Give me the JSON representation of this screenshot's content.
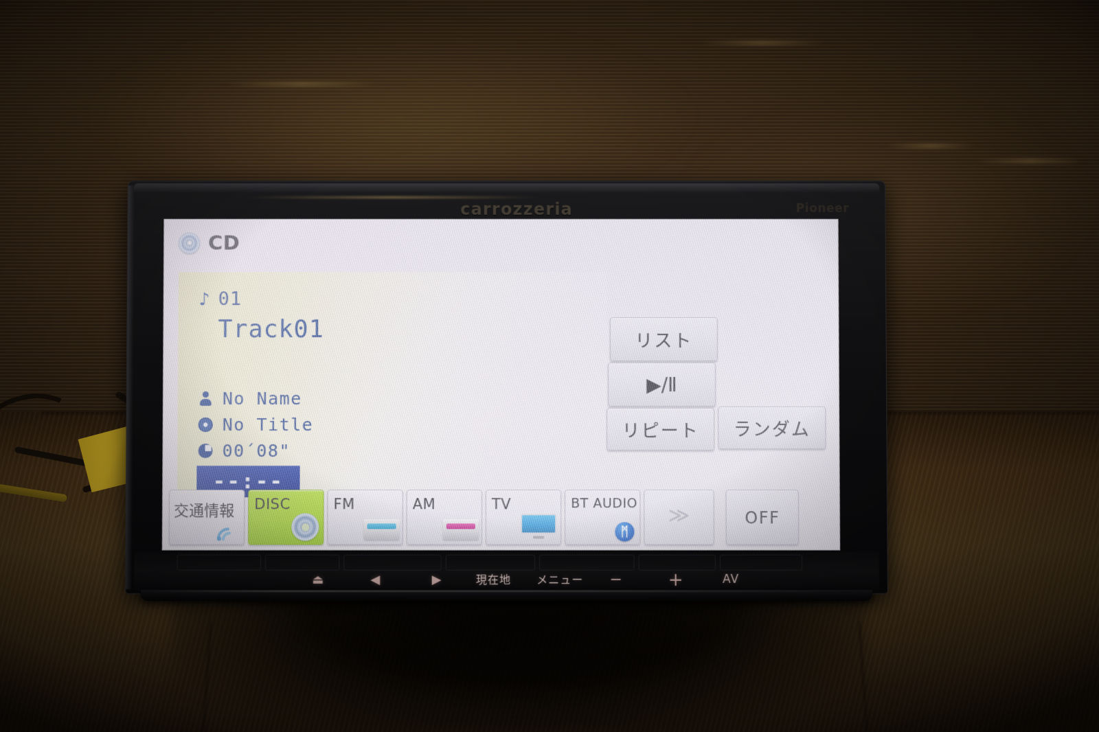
{
  "device": {
    "brand_left": "carrozzeria",
    "brand_right": "Pioneer"
  },
  "screen": {
    "source_header": {
      "icon": "cd-disc-icon",
      "label": "CD"
    },
    "now_playing": {
      "note_icon": "♪",
      "track_number": "01",
      "track_title": "Track01",
      "meta": [
        {
          "icon": "person-icon",
          "text": "No Name"
        },
        {
          "icon": "disc-icon",
          "text": "No Title"
        },
        {
          "icon": "clock-icon",
          "text": "00´08\""
        }
      ],
      "elapsed_time": "--:--"
    },
    "controls": [
      {
        "name": "list",
        "label": "リスト"
      },
      {
        "name": "play-pause",
        "label": "▶/Ⅱ"
      },
      {
        "name": "repeat",
        "label": "リピート"
      },
      {
        "name": "random",
        "label": "ランダム"
      }
    ],
    "source_bar": [
      {
        "name": "traffic-info",
        "label": "交通情報",
        "icon": "wifi-signal-icon",
        "active": false
      },
      {
        "name": "disc",
        "label": "DISC",
        "icon": "disc-icon",
        "active": true
      },
      {
        "name": "fm",
        "label": "FM",
        "icon": "tuner-fm-icon",
        "active": false
      },
      {
        "name": "am",
        "label": "AM",
        "icon": "tuner-am-icon",
        "active": false
      },
      {
        "name": "tv",
        "label": "TV",
        "icon": "tv-icon",
        "active": false
      },
      {
        "name": "bt-audio",
        "label": "BT AUDIO",
        "icon": "bluetooth-icon",
        "active": false
      },
      {
        "name": "next-page",
        "label": "≫",
        "icon": "chevron-double-right-icon",
        "active": false
      },
      {
        "name": "off",
        "label": "OFF",
        "icon": "",
        "active": false
      }
    ],
    "bluetooth_glyph": "ᛗ",
    "next_page_glyph": "≫"
  },
  "hardware_buttons": [
    {
      "name": "eject",
      "label": "⏏"
    },
    {
      "name": "track-previous",
      "label": "◀"
    },
    {
      "name": "track-next",
      "label": "▶"
    },
    {
      "name": "current-location",
      "label": "現在地"
    },
    {
      "name": "menu",
      "label": "メニュー"
    },
    {
      "name": "volume-down",
      "label": "−"
    },
    {
      "name": "volume-up",
      "label": "+"
    },
    {
      "name": "av",
      "label": "AV"
    }
  ],
  "colors": {
    "accent_active": "#a9dc2a",
    "text_blue": "#21408a",
    "time_chip_bg": "#1f3799",
    "bluetooth_blue": "#0a4fc0"
  }
}
